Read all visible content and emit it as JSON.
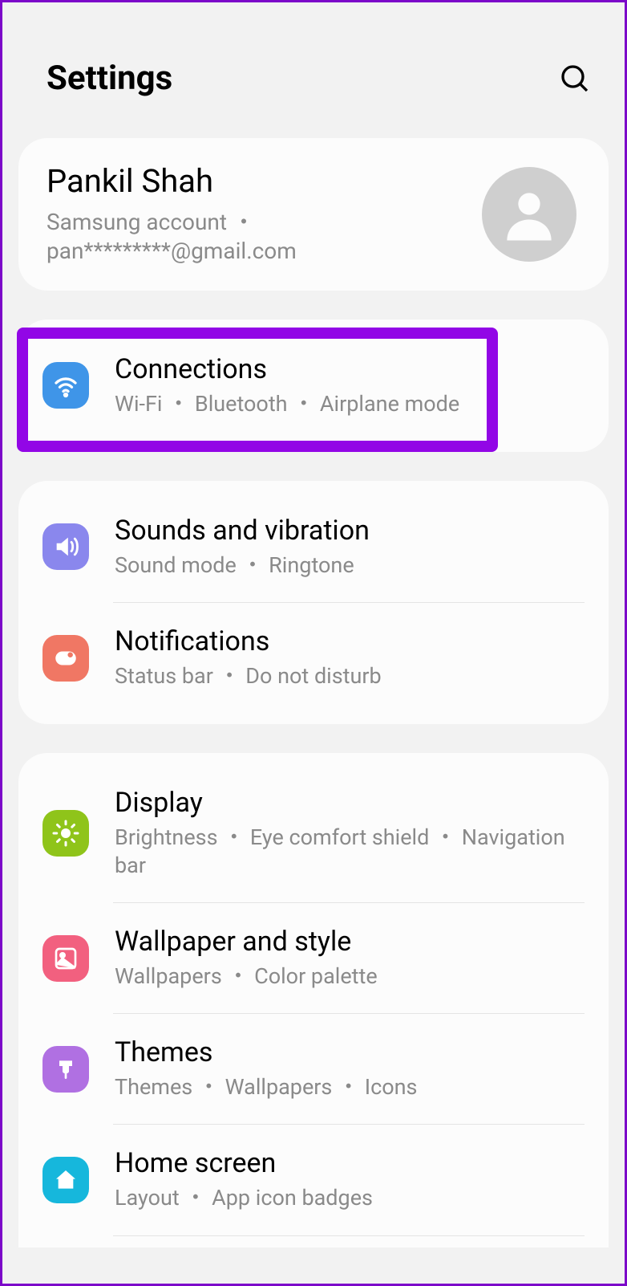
{
  "header": {
    "title": "Settings"
  },
  "account": {
    "name": "Pankil Shah",
    "subtitle": "Samsung account ・ pan*********@gmail.com"
  },
  "connections": {
    "title": "Connections",
    "subtitle": "Wi-Fi ・ Bluetooth ・ Airplane mode"
  },
  "sounds": {
    "title": "Sounds and vibration",
    "subtitle": "Sound mode ・ Ringtone"
  },
  "notifications": {
    "title": "Notifications",
    "subtitle": "Status bar ・ Do not disturb"
  },
  "display": {
    "title": "Display",
    "subtitle": "Brightness ・ Eye comfort shield ・ Navigation bar"
  },
  "wallpaper": {
    "title": "Wallpaper and style",
    "subtitle": "Wallpapers ・ Color palette"
  },
  "themes": {
    "title": "Themes",
    "subtitle": "Themes ・ Wallpapers ・ Icons"
  },
  "home": {
    "title": "Home screen",
    "subtitle": "Layout ・ App icon badges"
  }
}
